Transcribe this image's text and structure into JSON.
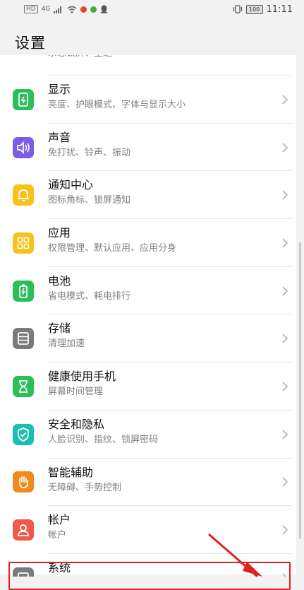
{
  "status_bar": {
    "left_labels": [
      "HD",
      "4G"
    ],
    "battery": "100",
    "time": "11:11"
  },
  "page_title": "设置",
  "items": [
    {
      "title": "",
      "subtitle": "杂志锁屏、主题",
      "icon": "wallpaper-icon",
      "color": "#2bbf5a"
    },
    {
      "title": "显示",
      "subtitle": "亮度、护眼模式、字体与显示大小",
      "icon": "display-icon",
      "color": "#2bbf5a"
    },
    {
      "title": "声音",
      "subtitle": "免打扰、铃声、振动",
      "icon": "sound-icon",
      "color": "#7c5ce6"
    },
    {
      "title": "通知中心",
      "subtitle": "图标角标、锁屏通知",
      "icon": "bell-icon",
      "color": "#f7c21a"
    },
    {
      "title": "应用",
      "subtitle": "权限管理、默认应用、应用分身",
      "icon": "apps-grid-icon",
      "color": "#f7c21a"
    },
    {
      "title": "电池",
      "subtitle": "省电模式、耗电排行",
      "icon": "battery-icon",
      "color": "#2bbf5a"
    },
    {
      "title": "存储",
      "subtitle": "清理加速",
      "icon": "storage-icon",
      "color": "#7a7a7a"
    },
    {
      "title": "健康使用手机",
      "subtitle": "屏幕时间管理",
      "icon": "hourglass-icon",
      "color": "#2bbf5a"
    },
    {
      "title": "安全和隐私",
      "subtitle": "人脸识别、指纹、锁屏密码",
      "icon": "shield-icon",
      "color": "#1bbfb1"
    },
    {
      "title": "智能辅助",
      "subtitle": "无障碍、手势控制",
      "icon": "hand-icon",
      "color": "#f08a1e"
    },
    {
      "title": "帐户",
      "subtitle": "帐户",
      "icon": "account-icon",
      "color": "#f05a4a"
    },
    {
      "title": "系统",
      "subtitle": "",
      "icon": "system-icon",
      "color": "#7a7a7a"
    }
  ],
  "annotation_color": "#e02020"
}
